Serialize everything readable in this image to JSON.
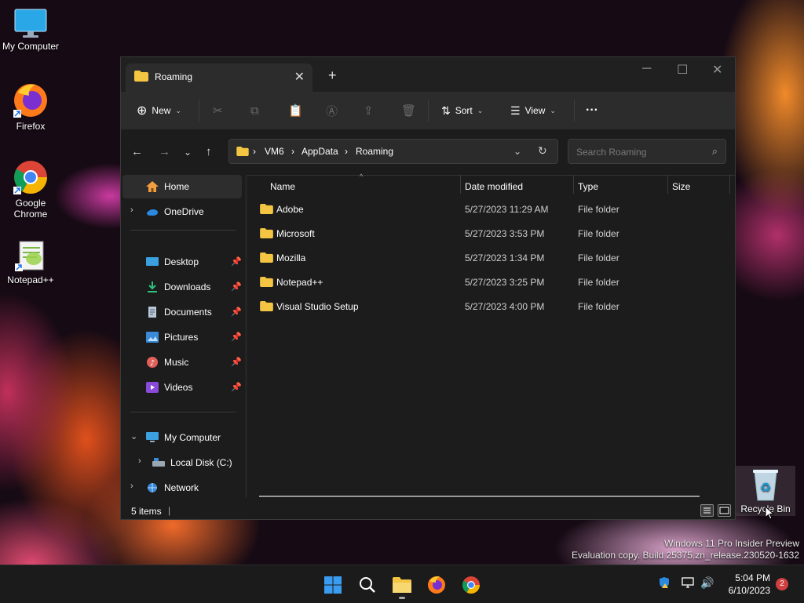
{
  "desktop": {
    "icons": [
      {
        "label": "My Computer"
      },
      {
        "label": "Firefox"
      },
      {
        "label": "Google Chrome"
      },
      {
        "label": "Notepad++"
      },
      {
        "label": "Recycle Bin"
      }
    ],
    "watermark_line1": "Windows 11 Pro Insider Preview",
    "watermark_line2": "Evaluation copy. Build 25375.zn_release.230520-1632"
  },
  "explorer": {
    "tab_title": "Roaming",
    "toolbar": {
      "new_label": "New",
      "sort_label": "Sort",
      "view_label": "View",
      "more_label": "···"
    },
    "breadcrumb": [
      "VM6",
      "AppData",
      "Roaming"
    ],
    "search_placeholder": "Search Roaming",
    "sidebar": {
      "home": "Home",
      "onedrive": "OneDrive",
      "quick_access": [
        "Desktop",
        "Downloads",
        "Documents",
        "Pictures",
        "Music",
        "Videos"
      ],
      "my_computer": "My Computer",
      "local_disk": "Local Disk (C:)",
      "network": "Network"
    },
    "columns": {
      "name": "Name",
      "date": "Date modified",
      "type": "Type",
      "size": "Size"
    },
    "files": [
      {
        "name": "Adobe",
        "date": "5/27/2023 11:29 AM",
        "type": "File folder"
      },
      {
        "name": "Microsoft",
        "date": "5/27/2023 3:53 PM",
        "type": "File folder"
      },
      {
        "name": "Mozilla",
        "date": "5/27/2023 1:34 PM",
        "type": "File folder"
      },
      {
        "name": "Notepad++",
        "date": "5/27/2023 3:25 PM",
        "type": "File folder"
      },
      {
        "name": "Visual Studio Setup",
        "date": "5/27/2023 4:00 PM",
        "type": "File folder"
      }
    ],
    "status": "5 items"
  },
  "taskbar": {
    "time": "5:04 PM",
    "date": "6/10/2023",
    "notification_count": "2"
  },
  "colors": {
    "folder": "#f4c542",
    "accent": "#0078d4"
  }
}
